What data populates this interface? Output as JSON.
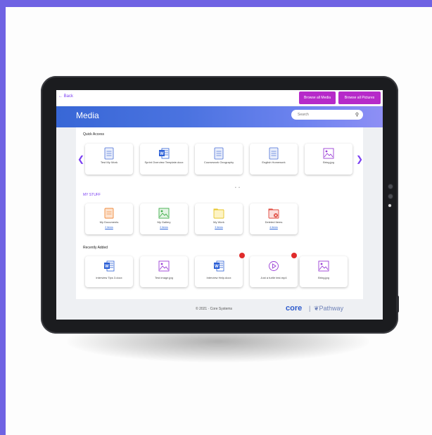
{
  "topbar": {
    "back_label": "← Back",
    "browse_media_label": "Browse all Media",
    "browse_pictures_label": "Browse all Pictures"
  },
  "header": {
    "title": "Media",
    "search_placeholder": "Search"
  },
  "quick_access": {
    "title": "Quick Access",
    "items": [
      {
        "label": "Test My Work",
        "icon": "document-icon"
      },
      {
        "label": "Sprint Overview Template.docx",
        "icon": "word-icon"
      },
      {
        "label": "Coursework Geography",
        "icon": "document-icon"
      },
      {
        "label": "English Homework",
        "icon": "document-icon"
      },
      {
        "label": "Bring.jpg",
        "icon": "image-icon"
      }
    ]
  },
  "my_stuff": {
    "title": "MY STUFF",
    "items": [
      {
        "label": "My Documents",
        "count": "2 items",
        "icon": "folder-icon",
        "color": "#f08a3c"
      },
      {
        "label": "My Gallery",
        "count": "2 items",
        "icon": "gallery-icon",
        "color": "#3fae4a"
      },
      {
        "label": "My Work",
        "count": "3 items",
        "icon": "folder-icon",
        "color": "#e7c62b"
      },
      {
        "label": "Deleted Items",
        "count": "4 items",
        "icon": "trash-icon",
        "color": "#e0493e"
      }
    ]
  },
  "recently_added": {
    "title": "Recently Added",
    "items": [
      {
        "label": "Interview Tips 3.docx",
        "icon": "word-icon"
      },
      {
        "label": "Test image.jpg",
        "icon": "image-icon"
      },
      {
        "label": "Interview Help.docx",
        "icon": "word-icon"
      },
      {
        "label": "Just a turtle test.mp4",
        "icon": "play-icon"
      },
      {
        "label": "Bring.jpg",
        "icon": "image-icon"
      }
    ]
  },
  "footer": {
    "copyright": "© 2021 · Core Systems",
    "logo_core": "core",
    "logo_pathway": "Pathway"
  },
  "colors": {
    "background": "#6f63e3",
    "accent_purple": "#7b3ff2",
    "button_magenta": "#b62ac9",
    "header_blue": "#3867d6"
  }
}
